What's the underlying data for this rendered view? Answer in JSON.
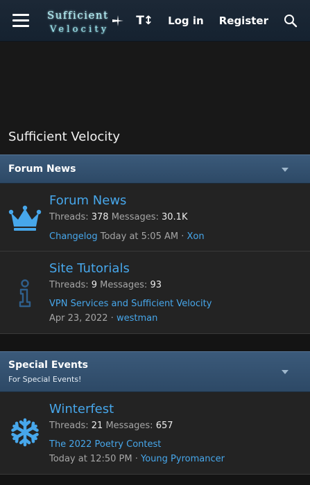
{
  "header": {
    "logo_text_line1": "Sufficient",
    "logo_text_line2": "Velocity",
    "login_label": "Log in",
    "register_label": "Register"
  },
  "page": {
    "title": "Sufficient Velocity"
  },
  "categories": [
    {
      "title": "Forum News",
      "description": "",
      "forums": [
        {
          "title": "Forum News",
          "icon": "crown-icon",
          "threads_label": "Threads:",
          "threads": "378",
          "messages_label": "Messages:",
          "messages": "30.1K",
          "latest_thread": "Changelog",
          "latest_date": "Today at 5:05 AM",
          "latest_user": "Xon"
        },
        {
          "title": "Site Tutorials",
          "icon": "info-icon",
          "threads_label": "Threads:",
          "threads": "9",
          "messages_label": "Messages:",
          "messages": "93",
          "latest_thread": "VPN Services and Sufficient Velocity",
          "latest_date": "Apr 23, 2022",
          "latest_user": "westman"
        }
      ]
    },
    {
      "title": "Special Events",
      "description": "For Special Events!",
      "forums": [
        {
          "title": "Winterfest",
          "icon": "snowflake-icon",
          "threads_label": "Threads:",
          "threads": "21",
          "messages_label": "Messages:",
          "messages": "657",
          "latest_thread": "The 2022 Poetry Contest",
          "latest_date": "Today at 12:50 PM",
          "latest_user": "Young Pyromancer"
        }
      ]
    }
  ],
  "separator": "·",
  "colors": {
    "accent_link": "#47a7eb",
    "category_header": "#34506f",
    "node_background": "#232323",
    "topbar": "#1a2634"
  }
}
